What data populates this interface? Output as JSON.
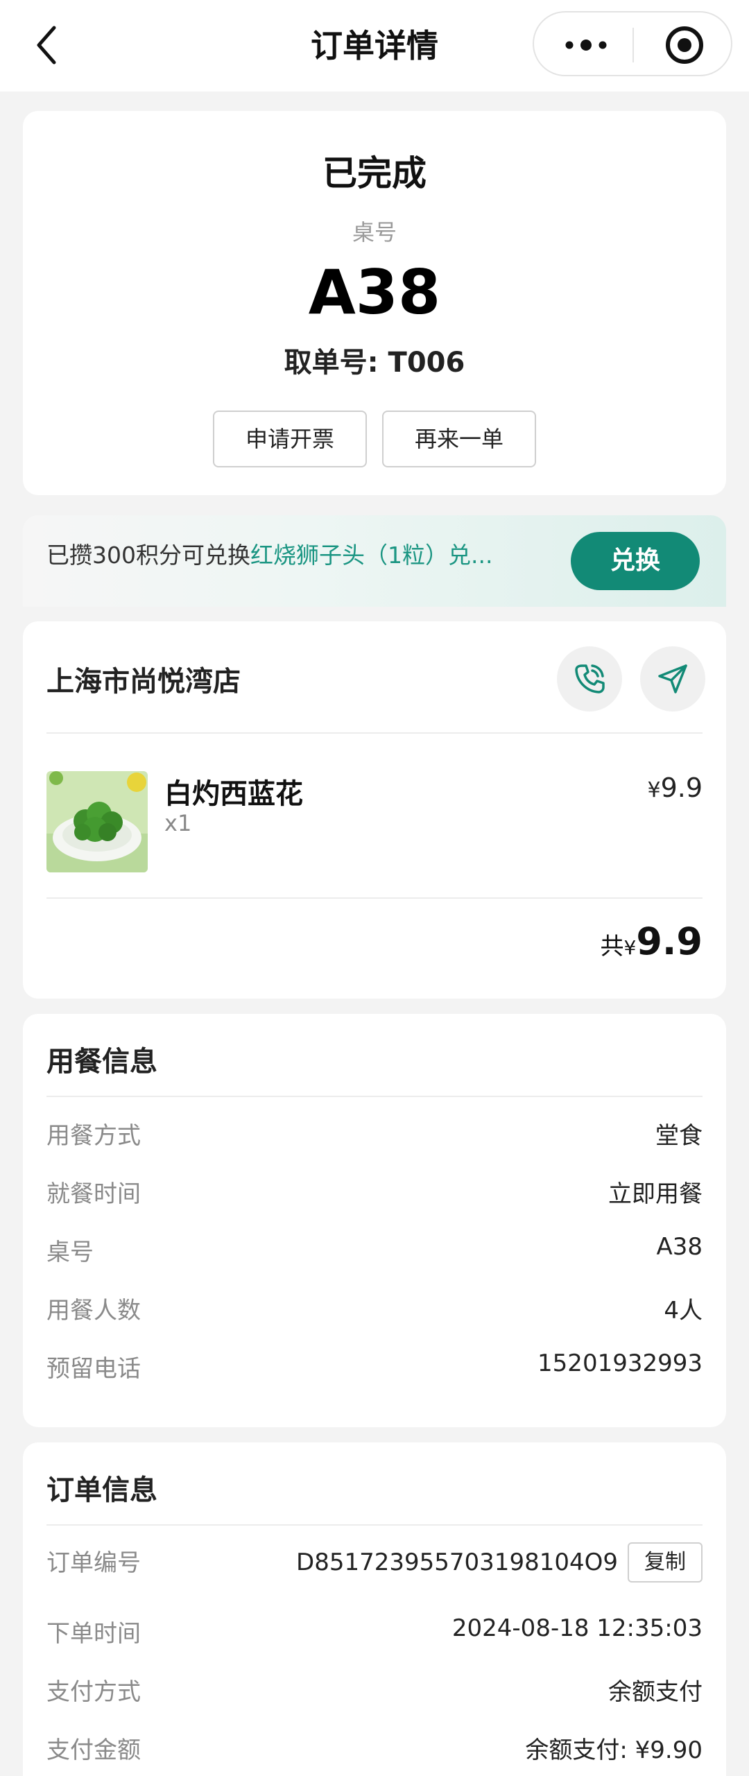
{
  "nav": {
    "title": "订单详情",
    "back_icon": "chevron-left-icon",
    "more_icon": "more-dots-icon",
    "target_icon": "target-icon"
  },
  "status": {
    "title": "已完成",
    "table_label": "桌号",
    "table_number": "A38",
    "pickup_label": "取单号: T006",
    "invoice_button": "申请开票",
    "reorder_button": "再来一单"
  },
  "points": {
    "prefix": "已攒300积分可兑换",
    "highlight": "红烧狮子头（1粒）兑...",
    "redeem_button": "兑换"
  },
  "store": {
    "name": "上海市尚悦湾店",
    "phone_icon": "phone-icon",
    "navigate_icon": "navigation-arrow-icon",
    "items": [
      {
        "name": "白灼西蓝花",
        "qty": "x1",
        "currency": "¥",
        "price": "9.9"
      }
    ],
    "total_label": "共",
    "total_currency": "¥",
    "total_amount": "9.9"
  },
  "dining": {
    "title": "用餐信息",
    "rows": [
      {
        "key": "用餐方式",
        "value": "堂食"
      },
      {
        "key": "就餐时间",
        "value": "立即用餐"
      },
      {
        "key": "桌号",
        "value": "A38"
      },
      {
        "key": "用餐人数",
        "value": "4人"
      },
      {
        "key": "预留电话",
        "value": "15201932993"
      }
    ]
  },
  "order": {
    "title": "订单信息",
    "rows": [
      {
        "key": "订单编号",
        "value": "D851723955703198104O9",
        "action": "复制"
      },
      {
        "key": "下单时间",
        "value": "2024-08-18 12:35:03"
      },
      {
        "key": "支付方式",
        "value": "余额支付"
      },
      {
        "key": "支付金额",
        "value": "余额支付: ¥9.90"
      }
    ]
  },
  "colors": {
    "accent": "#128a76",
    "highlight": "#1a9582",
    "background": "#f3f3f3"
  }
}
